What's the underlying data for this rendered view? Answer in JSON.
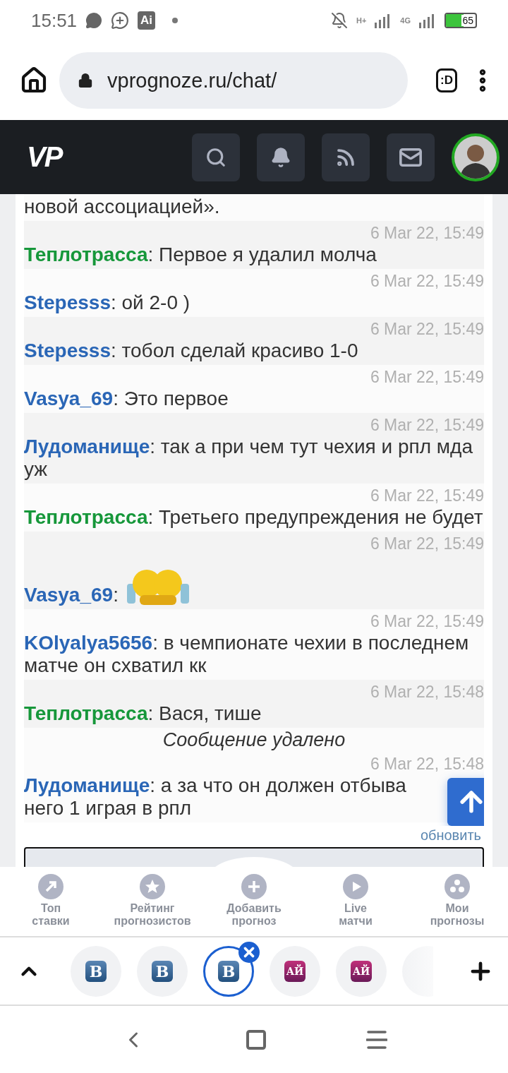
{
  "status_bar": {
    "time": "15:51",
    "ai_badge": "Ai",
    "network_1": "H+",
    "network_2": "4G",
    "battery": "65"
  },
  "browser": {
    "url": "vprognoze.ru/chat/",
    "extension": ":D"
  },
  "site_header": {
    "logo": "VP"
  },
  "chat": {
    "messages": [
      {
        "kind": "tail",
        "text": "новой ассоциацией»."
      },
      {
        "kind": "message",
        "time": "6 Mar 22, 15:49",
        "author": "Теплотрасса",
        "color": "#16973a",
        "text": "Первое я удалил молча"
      },
      {
        "kind": "message",
        "time": "6 Mar 22, 15:49",
        "author": "Stepesss",
        "color": "#2a66b6",
        "text": "ой 2-0 )"
      },
      {
        "kind": "message",
        "time": "6 Mar 22, 15:49",
        "author": "Stepesss",
        "color": "#2a66b6",
        "text": "тобол сделай красиво 1-0"
      },
      {
        "kind": "message",
        "time": "6 Mar 22, 15:49",
        "author": "Vasya_69",
        "color": "#2a66b6",
        "text": "Это первое"
      },
      {
        "kind": "message",
        "time": "6 Mar 22, 15:49",
        "author": "Лудоманище",
        "color": "#2a66b6",
        "text": "так а при чем тут чехия и рпл мда уж"
      },
      {
        "kind": "message",
        "time": "6 Mar 22, 15:49",
        "author": "Теплотрасса",
        "color": "#16973a",
        "text": "Третьего предупреждения не будет"
      },
      {
        "kind": "emoji",
        "time": "6 Mar 22, 15:49",
        "author": "Vasya_69",
        "color": "#2a66b6"
      },
      {
        "kind": "message",
        "time": "6 Mar 22, 15:49",
        "author": "KOlyalya5656",
        "color": "#2a66b6",
        "text": "в чемпионате чехии в последнем матче он схватил кк"
      },
      {
        "kind": "message",
        "time": "6 Mar 22, 15:48",
        "author": "Теплотрасса",
        "color": "#16973a",
        "text": "Вася, тише"
      },
      {
        "kind": "deleted",
        "text": "Сообщение удалено"
      },
      {
        "kind": "message",
        "time": "6 Mar 22, 15:48",
        "author": "Лудоманище",
        "color": "#2a66b6",
        "text": "а за что он должен отбыва",
        "continued": "него 1 играя в рпл"
      }
    ],
    "separator": ":",
    "refresh_link": "обновить"
  },
  "bottom_nav": [
    {
      "kind": "arrow",
      "line1": "Топ",
      "line2": "ставки"
    },
    {
      "kind": "star",
      "line1": "Рейтинг",
      "line2": "прогнозистов"
    },
    {
      "kind": "plus",
      "line1": "Добавить",
      "line2": "прогноз"
    },
    {
      "kind": "play",
      "line1": "Live",
      "line2": "матчи"
    },
    {
      "kind": "dots",
      "line1": "Мои",
      "line2": "прогнозы"
    }
  ],
  "tab_strip": [
    {
      "kind": "vk",
      "label": "В",
      "selected": false
    },
    {
      "kind": "vk",
      "label": "В",
      "selected": false
    },
    {
      "kind": "vk",
      "label": "В",
      "selected": true
    },
    {
      "kind": "ay",
      "label": "АЙ",
      "selected": false
    },
    {
      "kind": "ay",
      "label": "АЙ",
      "selected": false
    },
    {
      "kind": "blank",
      "selected": false
    }
  ]
}
